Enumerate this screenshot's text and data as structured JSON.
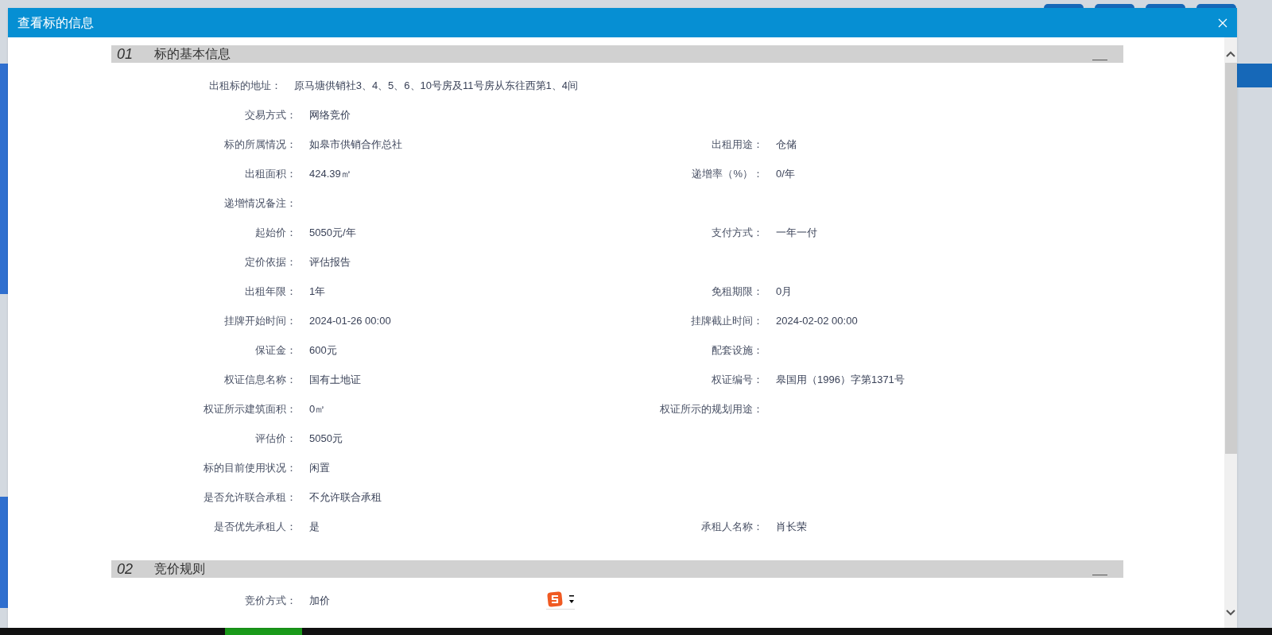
{
  "dialog": {
    "title": "查看标的信息"
  },
  "sections": [
    {
      "number": "01",
      "title": "标的基本信息",
      "rows": [
        {
          "fields": [
            {
              "label": "出租标的地址：",
              "value": "原马塘供销社3、4、5、6、10号房及11号房从东往西第1、4间"
            }
          ]
        },
        {
          "fields": [
            {
              "label": "交易方式：",
              "value": "网络竞价"
            }
          ]
        },
        {
          "fields": [
            {
              "label": "标的所属情况：",
              "value": "如皋市供销合作总社"
            },
            {
              "label": "出租用途：",
              "value": "仓储"
            }
          ]
        },
        {
          "fields": [
            {
              "label": "出租面积：",
              "value": "424.39㎡"
            },
            {
              "label": "递增率（%）：",
              "value": "0/年"
            }
          ]
        },
        {
          "fields": [
            {
              "label": "递增情况备注："
            }
          ]
        },
        {
          "fields": [
            {
              "label": "起始价：",
              "value": "5050元/年"
            },
            {
              "label": "支付方式：",
              "value": "一年一付"
            }
          ]
        },
        {
          "fields": [
            {
              "label": "定价依据：",
              "value": "评估报告"
            }
          ]
        },
        {
          "fields": [
            {
              "label": "出租年限：",
              "value": "1年"
            },
            {
              "label": "免租期限：",
              "value": "0月"
            }
          ]
        },
        {
          "fields": [
            {
              "label": "挂牌开始时间：",
              "value": "2024-01-26 00:00"
            },
            {
              "label": "挂牌截止时间：",
              "value": "2024-02-02 00:00"
            }
          ]
        },
        {
          "fields": [
            {
              "label": "保证金：",
              "value": "600元"
            },
            {
              "label": "配套设施："
            }
          ]
        },
        {
          "fields": [
            {
              "label": "权证信息名称：",
              "value": "国有土地证"
            },
            {
              "label": "权证编号：",
              "value": "皋国用（1996）字第1371号"
            }
          ]
        },
        {
          "fields": [
            {
              "label": "权证所示建筑面积：",
              "value": "0㎡"
            },
            {
              "label": "权证所示的规划用途："
            }
          ]
        },
        {
          "fields": [
            {
              "label": "评估价：",
              "value": "5050元"
            }
          ]
        },
        {
          "fields": [
            {
              "label": "标的目前使用状况：",
              "value": "闲置"
            }
          ]
        },
        {
          "fields": [
            {
              "label": "是否允许联合承租：",
              "value": "不允许联合承租"
            }
          ]
        },
        {
          "fields": [
            {
              "label": "是否优先承租人：",
              "value": "是"
            },
            {
              "label": "承租人名称：",
              "value": "肖长荣"
            }
          ]
        }
      ]
    },
    {
      "number": "02",
      "title": "竞价规则",
      "rows": [
        {
          "fields": [
            {
              "label": "竞价方式：",
              "value": "加价"
            }
          ]
        }
      ]
    }
  ]
}
